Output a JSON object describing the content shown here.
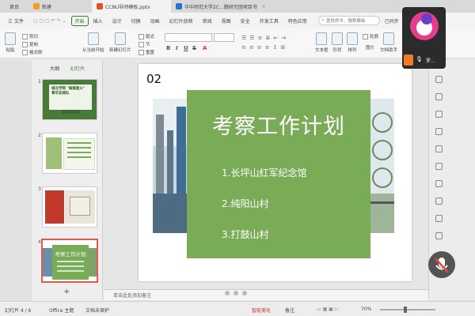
{
  "tabs": {
    "home": "首页",
    "items": [
      {
        "label": "新建"
      },
      {
        "label": "CCNU导师模板.pptx"
      },
      {
        "label": "华中师范大学2C...题研究团项目书"
      }
    ]
  },
  "menu": {
    "file": "三 文件",
    "items": [
      "开始",
      "插入",
      "设计",
      "切换",
      "动画",
      "幻灯片放映",
      "审阅",
      "视图",
      "安全",
      "开发工具",
      "特色应用"
    ],
    "active": "开始",
    "search_placeholder": "查找命令、搜索模板",
    "right_ops": [
      "已同步",
      "分享"
    ]
  },
  "ribbon": {
    "paste": "粘贴",
    "cut": "剪切",
    "copy": "复制",
    "format_painter": "格式刷",
    "from_current": "从当前开始",
    "new_slide": "新建幻灯片",
    "layout": "版式",
    "section": "节",
    "reset": "重置",
    "textbox": "文本框",
    "shape": "形状",
    "arrange": "排列",
    "outline": "轮廓",
    "picture": "图片",
    "doc_assistant": "文档助手",
    "bold": "B",
    "italic": "I",
    "underline": "U",
    "strike": "S",
    "font_color": "A"
  },
  "panel": {
    "tabs": [
      "大纲",
      "幻灯片"
    ],
    "slide_numbers": [
      "1",
      "2",
      "3",
      "4"
    ],
    "thumb1_title": "城北学院 \"高都星火\" 青年实践队",
    "thumb4_title": "考察工作计划",
    "add": "+"
  },
  "slide": {
    "number": "02",
    "title": "考察工作计划",
    "items": [
      "1.长坪山红军纪念馆",
      "2.纯阳山村",
      "3.打鼓山村"
    ]
  },
  "notes_placeholder": "单击此处添加备注",
  "status": {
    "slide_info": "幻灯片 4 / 6",
    "theme": "Office 主题",
    "doc_protect": "文档未保护",
    "beautify": "智能美化",
    "notes_label": "备注",
    "zoom": "70%"
  },
  "overlay": {
    "user_name": "罗..."
  },
  "colors": {
    "slide_green": "#7aab57",
    "active_tab": "#2e7d32",
    "selected_thumb_border": "#e05a4b"
  }
}
